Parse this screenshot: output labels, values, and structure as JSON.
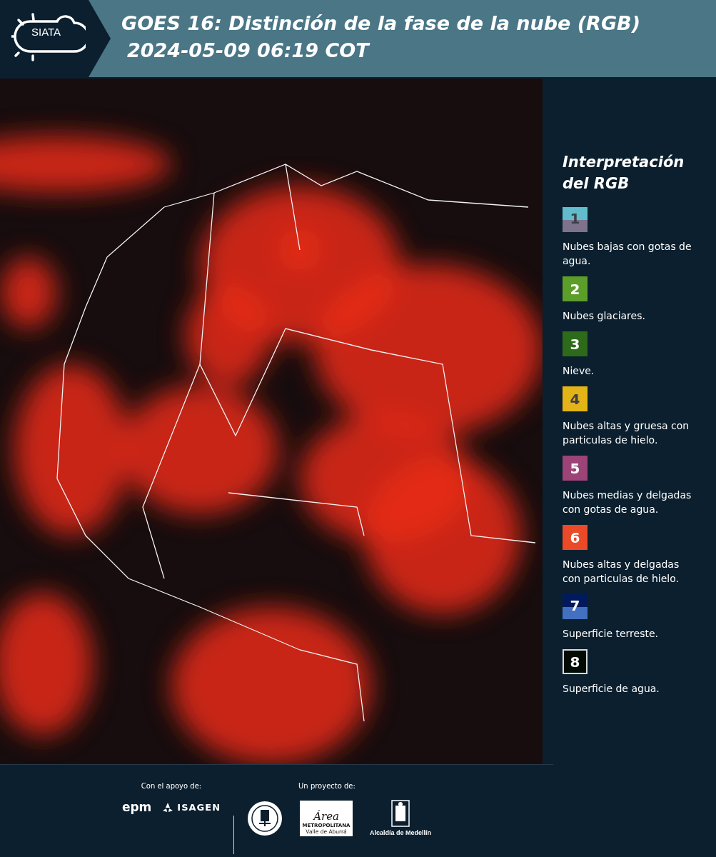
{
  "header": {
    "logo_text": "SIATA",
    "title": "GOES 16: Distinción de la fase de la nube (RGB)",
    "timestamp": "2024-05-09 06:19 COT"
  },
  "legend": {
    "title": "Interpretación del RGB",
    "items": [
      {
        "number": "1",
        "label": "Nubes bajas con gotas de agua.",
        "bands": [
          {
            "color": "#62bccb"
          },
          {
            "color": "#7d738d"
          }
        ]
      },
      {
        "number": "2",
        "label": "Nubes glaciares.",
        "color": "#5c9e2a"
      },
      {
        "number": "3",
        "label": "Nieve.",
        "color": "#2d6a1a"
      },
      {
        "number": "4",
        "label": "Nubes altas y gruesa con particulas de hielo.",
        "color": "#e3b417"
      },
      {
        "number": "5",
        "label": "Nubes medias y delgadas con gotas de agua.",
        "color": "#9c4377"
      },
      {
        "number": "6",
        "label": "Nubes altas y delgadas con particulas de hielo.",
        "color": "#ea4a27"
      },
      {
        "number": "7",
        "label": "Superficie terreste.",
        "bands": [
          {
            "color": "#011a5e"
          },
          {
            "color": "#4470c2"
          }
        ]
      },
      {
        "number": "8",
        "label": "Superficie de agua.",
        "color": "#010b03"
      }
    ]
  },
  "footer": {
    "support_label": "Con el apoyo de:",
    "support_logos": [
      "epm",
      "ISAGEN"
    ],
    "project_label": "Un proyecto de:",
    "metro_logo": {
      "script": "Área",
      "line1": "METROPOLITANA",
      "line2": "Valle de Aburrá"
    },
    "city_logo": "Alcaldía de Medellín"
  }
}
